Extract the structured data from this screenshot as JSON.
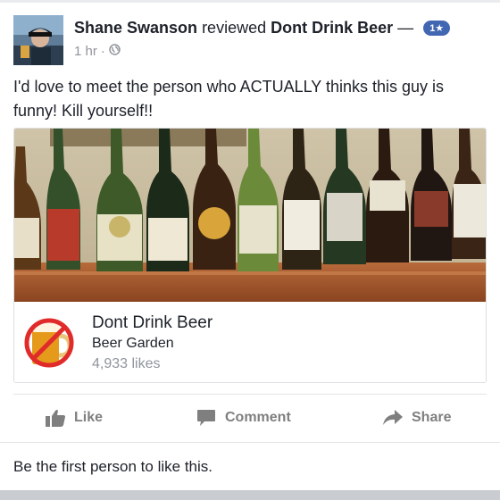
{
  "post": {
    "author": "Shane Swanson",
    "verb": "reviewed",
    "page": "Dont Drink Beer",
    "dash": "—",
    "rating_badge": "1★",
    "time": "1 hr",
    "separator": "·",
    "privacy_icon": "globe-icon",
    "text": "I'd love to meet the person who ACTUALLY thinks this guy is funny!  Kill yourself!!"
  },
  "attachment": {
    "page_name": "Dont Drink Beer",
    "category": "Beer Garden",
    "likes": "4,933 likes"
  },
  "actions": {
    "like": "Like",
    "comment": "Comment",
    "share": "Share"
  },
  "footer": {
    "likes_text": "Be the first person to like this."
  },
  "colors": {
    "accent": "#4267b2",
    "muted": "#90949c",
    "action": "#7f7f7f"
  }
}
